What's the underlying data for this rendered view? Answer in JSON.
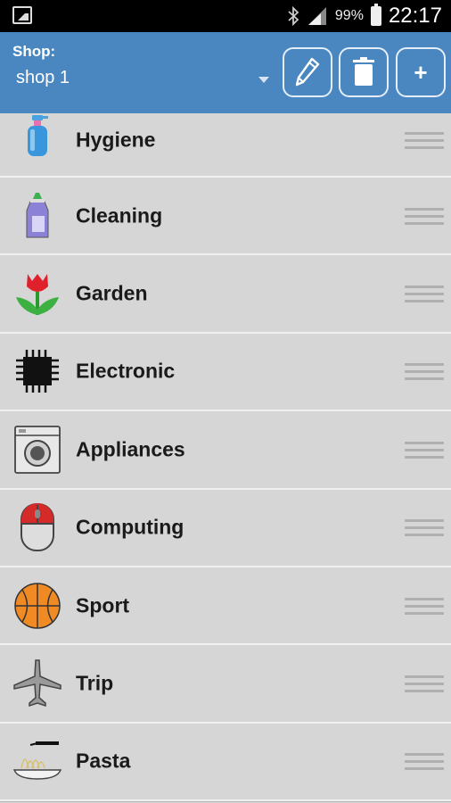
{
  "statusbar": {
    "battery_pct": "99%",
    "time": "22:17"
  },
  "header": {
    "shop_label": "Shop:",
    "shop_value": "shop 1",
    "add_label": "+"
  },
  "colors": {
    "appbar": "#4a87c0",
    "list_bg": "#d6d6d6"
  },
  "categories": [
    {
      "label": "Hygiene",
      "icon": "spray-bottle-icon"
    },
    {
      "label": "Cleaning",
      "icon": "detergent-bottle-icon"
    },
    {
      "label": "Garden",
      "icon": "tulip-icon"
    },
    {
      "label": "Electronic",
      "icon": "chip-icon"
    },
    {
      "label": "Appliances",
      "icon": "washing-machine-icon"
    },
    {
      "label": "Computing",
      "icon": "computer-mouse-icon"
    },
    {
      "label": "Sport",
      "icon": "basketball-icon"
    },
    {
      "label": "Trip",
      "icon": "airplane-icon"
    },
    {
      "label": "Pasta",
      "icon": "pasta-plate-icon"
    }
  ]
}
